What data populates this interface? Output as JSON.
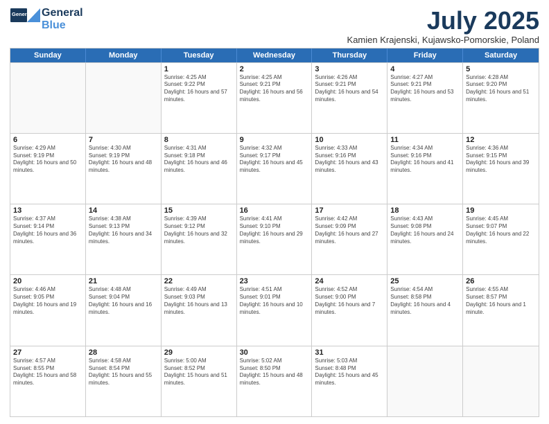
{
  "header": {
    "logo_line1": "General",
    "logo_line2": "Blue",
    "title": "July 2025",
    "subtitle": "Kamien Krajenski, Kujawsko-Pomorskie, Poland"
  },
  "days": [
    "Sunday",
    "Monday",
    "Tuesday",
    "Wednesday",
    "Thursday",
    "Friday",
    "Saturday"
  ],
  "weeks": [
    [
      {
        "num": "",
        "text": ""
      },
      {
        "num": "",
        "text": ""
      },
      {
        "num": "1",
        "text": "Sunrise: 4:25 AM\nSunset: 9:22 PM\nDaylight: 16 hours and 57 minutes."
      },
      {
        "num": "2",
        "text": "Sunrise: 4:25 AM\nSunset: 9:21 PM\nDaylight: 16 hours and 56 minutes."
      },
      {
        "num": "3",
        "text": "Sunrise: 4:26 AM\nSunset: 9:21 PM\nDaylight: 16 hours and 54 minutes."
      },
      {
        "num": "4",
        "text": "Sunrise: 4:27 AM\nSunset: 9:21 PM\nDaylight: 16 hours and 53 minutes."
      },
      {
        "num": "5",
        "text": "Sunrise: 4:28 AM\nSunset: 9:20 PM\nDaylight: 16 hours and 51 minutes."
      }
    ],
    [
      {
        "num": "6",
        "text": "Sunrise: 4:29 AM\nSunset: 9:19 PM\nDaylight: 16 hours and 50 minutes."
      },
      {
        "num": "7",
        "text": "Sunrise: 4:30 AM\nSunset: 9:19 PM\nDaylight: 16 hours and 48 minutes."
      },
      {
        "num": "8",
        "text": "Sunrise: 4:31 AM\nSunset: 9:18 PM\nDaylight: 16 hours and 46 minutes."
      },
      {
        "num": "9",
        "text": "Sunrise: 4:32 AM\nSunset: 9:17 PM\nDaylight: 16 hours and 45 minutes."
      },
      {
        "num": "10",
        "text": "Sunrise: 4:33 AM\nSunset: 9:16 PM\nDaylight: 16 hours and 43 minutes."
      },
      {
        "num": "11",
        "text": "Sunrise: 4:34 AM\nSunset: 9:16 PM\nDaylight: 16 hours and 41 minutes."
      },
      {
        "num": "12",
        "text": "Sunrise: 4:36 AM\nSunset: 9:15 PM\nDaylight: 16 hours and 39 minutes."
      }
    ],
    [
      {
        "num": "13",
        "text": "Sunrise: 4:37 AM\nSunset: 9:14 PM\nDaylight: 16 hours and 36 minutes."
      },
      {
        "num": "14",
        "text": "Sunrise: 4:38 AM\nSunset: 9:13 PM\nDaylight: 16 hours and 34 minutes."
      },
      {
        "num": "15",
        "text": "Sunrise: 4:39 AM\nSunset: 9:12 PM\nDaylight: 16 hours and 32 minutes."
      },
      {
        "num": "16",
        "text": "Sunrise: 4:41 AM\nSunset: 9:10 PM\nDaylight: 16 hours and 29 minutes."
      },
      {
        "num": "17",
        "text": "Sunrise: 4:42 AM\nSunset: 9:09 PM\nDaylight: 16 hours and 27 minutes."
      },
      {
        "num": "18",
        "text": "Sunrise: 4:43 AM\nSunset: 9:08 PM\nDaylight: 16 hours and 24 minutes."
      },
      {
        "num": "19",
        "text": "Sunrise: 4:45 AM\nSunset: 9:07 PM\nDaylight: 16 hours and 22 minutes."
      }
    ],
    [
      {
        "num": "20",
        "text": "Sunrise: 4:46 AM\nSunset: 9:05 PM\nDaylight: 16 hours and 19 minutes."
      },
      {
        "num": "21",
        "text": "Sunrise: 4:48 AM\nSunset: 9:04 PM\nDaylight: 16 hours and 16 minutes."
      },
      {
        "num": "22",
        "text": "Sunrise: 4:49 AM\nSunset: 9:03 PM\nDaylight: 16 hours and 13 minutes."
      },
      {
        "num": "23",
        "text": "Sunrise: 4:51 AM\nSunset: 9:01 PM\nDaylight: 16 hours and 10 minutes."
      },
      {
        "num": "24",
        "text": "Sunrise: 4:52 AM\nSunset: 9:00 PM\nDaylight: 16 hours and 7 minutes."
      },
      {
        "num": "25",
        "text": "Sunrise: 4:54 AM\nSunset: 8:58 PM\nDaylight: 16 hours and 4 minutes."
      },
      {
        "num": "26",
        "text": "Sunrise: 4:55 AM\nSunset: 8:57 PM\nDaylight: 16 hours and 1 minute."
      }
    ],
    [
      {
        "num": "27",
        "text": "Sunrise: 4:57 AM\nSunset: 8:55 PM\nDaylight: 15 hours and 58 minutes."
      },
      {
        "num": "28",
        "text": "Sunrise: 4:58 AM\nSunset: 8:54 PM\nDaylight: 15 hours and 55 minutes."
      },
      {
        "num": "29",
        "text": "Sunrise: 5:00 AM\nSunset: 8:52 PM\nDaylight: 15 hours and 51 minutes."
      },
      {
        "num": "30",
        "text": "Sunrise: 5:02 AM\nSunset: 8:50 PM\nDaylight: 15 hours and 48 minutes."
      },
      {
        "num": "31",
        "text": "Sunrise: 5:03 AM\nSunset: 8:48 PM\nDaylight: 15 hours and 45 minutes."
      },
      {
        "num": "",
        "text": ""
      },
      {
        "num": "",
        "text": ""
      }
    ]
  ]
}
